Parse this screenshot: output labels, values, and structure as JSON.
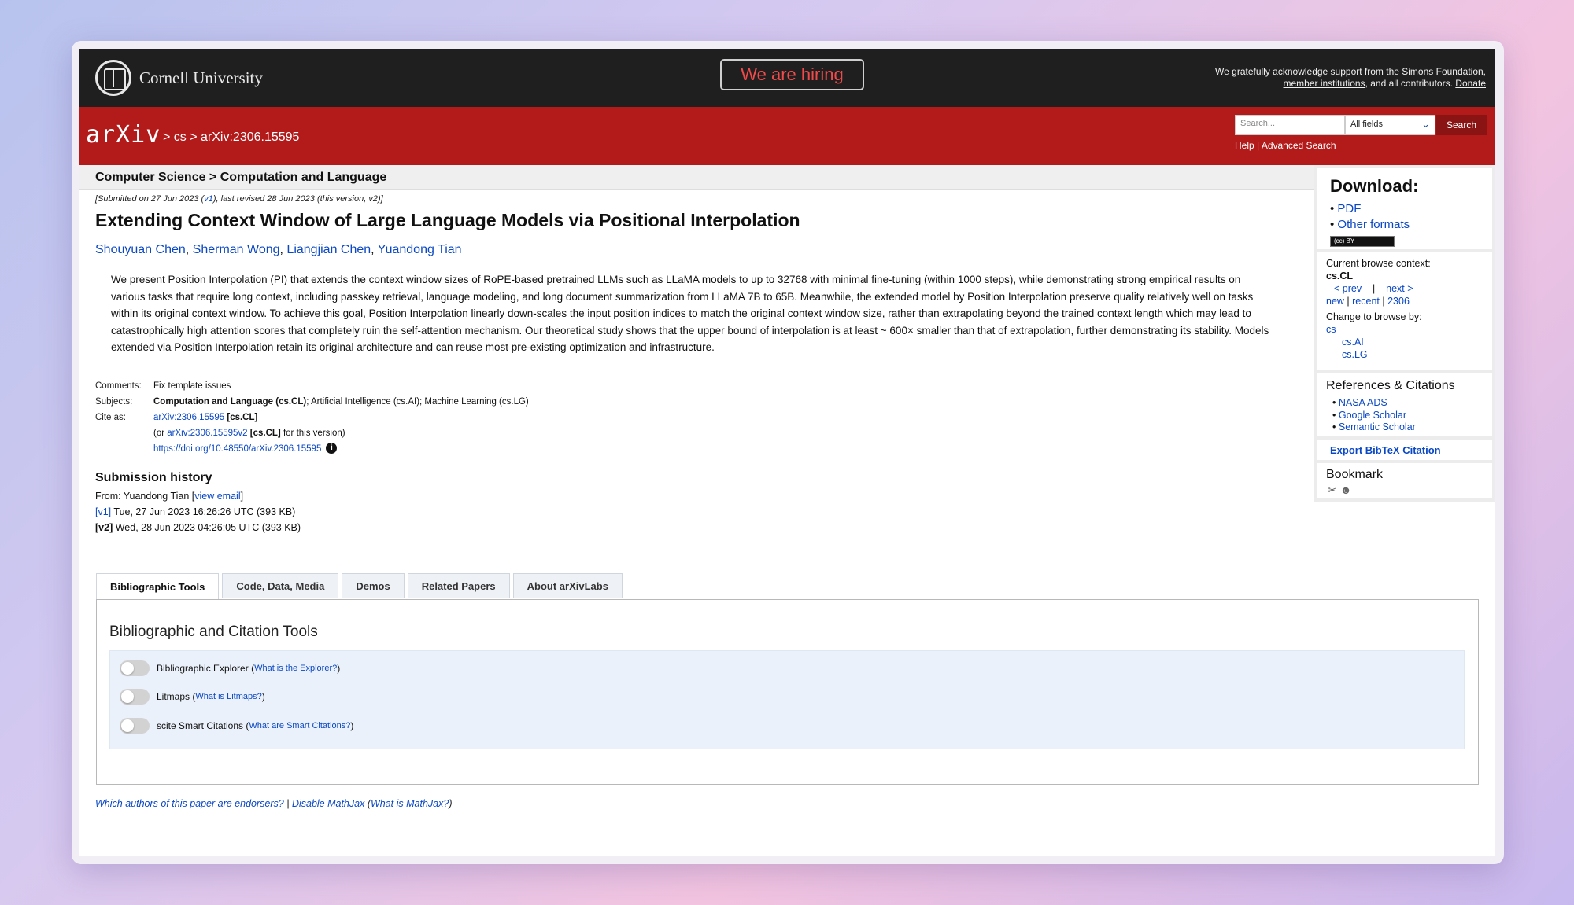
{
  "header": {
    "university": "Cornell University",
    "hiring": "We are hiring",
    "ack_line1": "We gratefully acknowledge support from the Simons Foundation,",
    "ack_member": "member institutions",
    "ack_mid": ", and all contributors.",
    "ack_donate": "Donate"
  },
  "nav": {
    "logo": "arXiv",
    "breadcrumb": "> cs > arXiv:2306.15595",
    "search_placeholder": "Search...",
    "field_selected": "All fields",
    "search_button": "Search",
    "help": "Help",
    "sep": "|",
    "advanced": "Advanced Search"
  },
  "subject_bar": "Computer Science > Computation and Language",
  "paper": {
    "dateline_pre": "[Submitted on 27 Jun 2023 (",
    "dateline_v1": "v1",
    "dateline_post": "), last revised 28 Jun 2023 (this version, v2)]",
    "title": "Extending Context Window of Large Language Models via Positional Interpolation",
    "authors": [
      "Shouyuan Chen",
      "Sherman Wong",
      "Liangjian Chen",
      "Yuandong Tian"
    ],
    "abstract": "We present Position Interpolation (PI) that extends the context window sizes of RoPE-based pretrained LLMs such as LLaMA models to up to 32768 with minimal fine-tuning (within 1000 steps), while demonstrating strong empirical results on various tasks that require long context, including passkey retrieval, language modeling, and long document summarization from LLaMA 7B to 65B. Meanwhile, the extended model by Position Interpolation preserve quality relatively well on tasks within its original context window. To achieve this goal, Position Interpolation linearly down-scales the input position indices to match the original context window size, rather than extrapolating beyond the trained context length which may lead to catastrophically high attention scores that completely ruin the self-attention mechanism. Our theoretical study shows that the upper bound of interpolation is at least ~ 600× smaller than that of extrapolation, further demonstrating its stability. Models extended via Position Interpolation retain its original architecture and can reuse most pre-existing optimization and infrastructure."
  },
  "meta": {
    "comments_label": "Comments:",
    "comments": "Fix template issues",
    "subjects_label": "Subjects:",
    "subjects_primary": "Computation and Language (cs.CL)",
    "subjects_rest": "; Artificial Intelligence (cs.AI); Machine Learning (cs.LG)",
    "cite_label": "Cite as:",
    "cite_id": "arXiv:2306.15595",
    "cite_cat": "[cs.CL]",
    "cite_or": "(or",
    "cite_v2": "arXiv:2306.15595v2",
    "cite_v2_cat": "[cs.CL]",
    "cite_v2_tail": "for this version)",
    "doi": "https://doi.org/10.48550/arXiv.2306.15595"
  },
  "history": {
    "title": "Submission history",
    "from_pre": "From: Yuandong Tian [",
    "from_link": "view email",
    "from_post": "]",
    "v1_tag": "[v1]",
    "v1_text": "Tue, 27 Jun 2023 16:26:26 UTC (393 KB)",
    "v2_tag": "[v2]",
    "v2_text": "Wed, 28 Jun 2023 04:26:05 UTC (393 KB)"
  },
  "tabs": [
    "Bibliographic Tools",
    "Code, Data, Media",
    "Demos",
    "Related Papers",
    "About arXivLabs"
  ],
  "panel": {
    "title": "Bibliographic and Citation Tools",
    "toggles": [
      {
        "label": "Bibliographic Explorer",
        "link": "What is the Explorer?"
      },
      {
        "label": "Litmaps",
        "link": "What is Litmaps?"
      },
      {
        "label": "scite Smart Citations",
        "link": "What are Smart Citations?"
      }
    ]
  },
  "footer": {
    "endorsers": "Which authors of this paper are endorsers?",
    "sep": "|",
    "mathjax": "Disable MathJax",
    "whatmj": "What is MathJax?"
  },
  "sidebar": {
    "download_title": "Download:",
    "pdf": "PDF",
    "other": "Other formats",
    "cc": "(cc) BY",
    "ctx_label": "Current browse context:",
    "ctx_value": "cs.CL",
    "prev": "< prev",
    "next": "next >",
    "new": "new",
    "recent": "recent",
    "month": "2306",
    "change_label": "Change to browse by:",
    "browse": [
      "cs",
      "cs.AI",
      "cs.LG"
    ],
    "refs_title": "References & Citations",
    "refs": [
      "NASA ADS",
      "Google Scholar",
      "Semantic Scholar"
    ],
    "bibtex": "Export BibTeX Citation",
    "bookmark": "Bookmark"
  }
}
